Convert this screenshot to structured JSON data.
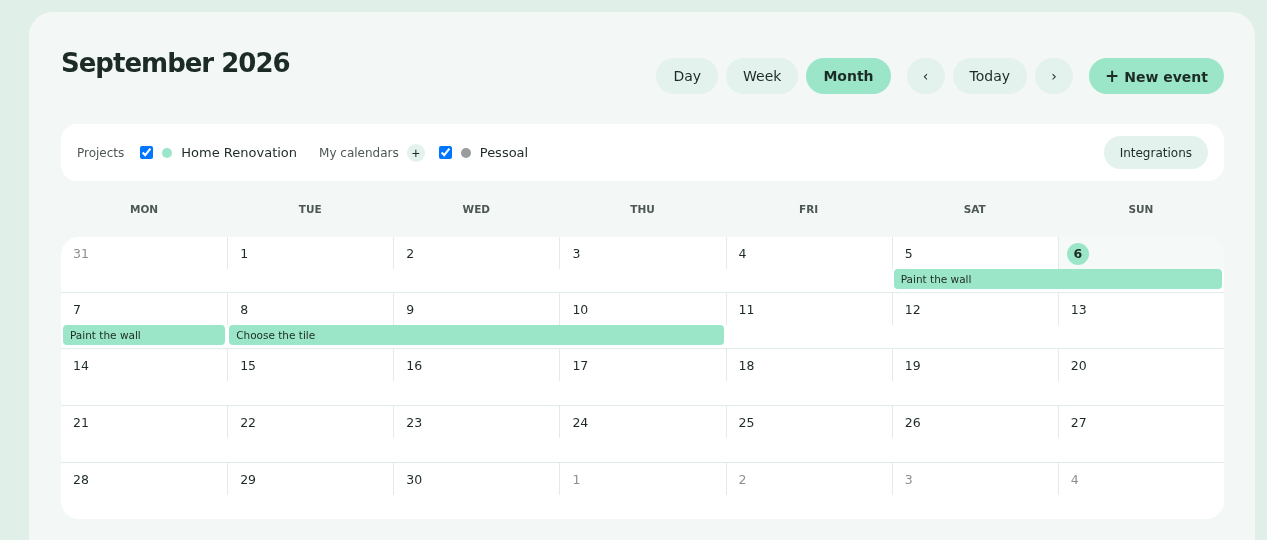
{
  "title": "September 2026",
  "views": [
    {
      "label": "Day",
      "selected": false
    },
    {
      "label": "Week",
      "selected": false
    },
    {
      "label": "Month",
      "selected": true
    }
  ],
  "nav": {
    "prev": "‹",
    "today": "Today",
    "next": "›"
  },
  "new_event": {
    "icon": "+",
    "label": "New event"
  },
  "filters": {
    "projects_label": "Projects",
    "projects": [
      {
        "name": "Home Renovation",
        "checked": true,
        "color": "#9be6c8"
      }
    ],
    "calendars_label": "My calendars",
    "add": "+",
    "calendars": [
      {
        "name": "Pessoal",
        "checked": true,
        "color": "#999d9b"
      }
    ],
    "integrations": "Integrations"
  },
  "weekdays": [
    "MON",
    "TUE",
    "WED",
    "THU",
    "FRI",
    "SAT",
    "SUN"
  ],
  "weeks": [
    {
      "days": [
        {
          "label": "31",
          "muted": true,
          "today": false
        },
        {
          "label": "1",
          "muted": false,
          "today": false
        },
        {
          "label": "2",
          "muted": false,
          "today": false
        },
        {
          "label": "3",
          "muted": false,
          "today": false
        },
        {
          "label": "4",
          "muted": false,
          "today": false
        },
        {
          "label": "5",
          "muted": false,
          "today": false,
          "event": {
            "title": "Paint the wall"
          }
        },
        {
          "label": "6",
          "muted": false,
          "today": true,
          "covered": true
        }
      ]
    },
    {
      "days": [
        {
          "label": "7",
          "muted": false,
          "today": false,
          "event": {
            "title": "Paint the wall"
          }
        },
        {
          "label": "8",
          "muted": false,
          "today": false,
          "event": {
            "title": "Choose the tile"
          }
        },
        {
          "label": "9",
          "muted": false,
          "today": false,
          "covered": true
        },
        {
          "label": "10",
          "muted": false,
          "today": false,
          "covered": true
        },
        {
          "label": "11",
          "muted": false,
          "today": false
        },
        {
          "label": "12",
          "muted": false,
          "today": false
        },
        {
          "label": "13",
          "muted": false,
          "today": false
        }
      ]
    },
    {
      "days": [
        {
          "label": "14",
          "muted": false,
          "today": false
        },
        {
          "label": "15",
          "muted": false,
          "today": false
        },
        {
          "label": "16",
          "muted": false,
          "today": false
        },
        {
          "label": "17",
          "muted": false,
          "today": false
        },
        {
          "label": "18",
          "muted": false,
          "today": false
        },
        {
          "label": "19",
          "muted": false,
          "today": false
        },
        {
          "label": "20",
          "muted": false,
          "today": false
        }
      ]
    },
    {
      "days": [
        {
          "label": "21",
          "muted": false,
          "today": false
        },
        {
          "label": "22",
          "muted": false,
          "today": false
        },
        {
          "label": "23",
          "muted": false,
          "today": false
        },
        {
          "label": "24",
          "muted": false,
          "today": false
        },
        {
          "label": "25",
          "muted": false,
          "today": false
        },
        {
          "label": "26",
          "muted": false,
          "today": false
        },
        {
          "label": "27",
          "muted": false,
          "today": false
        }
      ]
    },
    {
      "days": [
        {
          "label": "28",
          "muted": false,
          "today": false
        },
        {
          "label": "29",
          "muted": false,
          "today": false
        },
        {
          "label": "30",
          "muted": false,
          "today": false
        },
        {
          "label": "1",
          "muted": true,
          "today": false
        },
        {
          "label": "2",
          "muted": true,
          "today": false
        },
        {
          "label": "3",
          "muted": true,
          "today": false
        },
        {
          "label": "4",
          "muted": true,
          "today": false
        }
      ]
    }
  ]
}
